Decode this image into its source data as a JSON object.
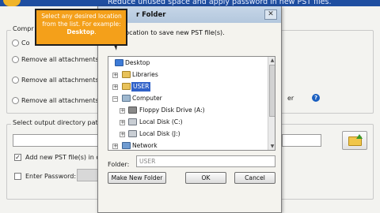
{
  "background_app": {
    "header_text": "Reduce unused space and apply password in new PST files.",
    "group_compress_label": "Compr",
    "radio_compact_label": "Co",
    "radio_remove_all_1": "Remove all attachments in",
    "radio_remove_all_2": "Remove all attachments fr",
    "radio_remove_all_3": "Remove all attachments fr",
    "radio_right_label": "er",
    "output_path_label": "Select output directory path fo",
    "add_new_pst_label": "Add new PST file(s) in ou",
    "enter_password_label": "Enter Password:",
    "colors": {
      "header": "#1f4ea0",
      "help_icon": "#1a5fc0"
    }
  },
  "dialog": {
    "title": "r Folder",
    "close_glyph": "✕",
    "instruction": "location to save new PST file(s).",
    "tree": [
      {
        "label": "Desktop",
        "expander": ""
      },
      {
        "label": "Libraries",
        "expander": "+"
      },
      {
        "label": "USER",
        "expander": "+",
        "selected": true
      },
      {
        "label": "Computer",
        "expander": "−"
      },
      {
        "label": "Floppy Disk Drive (A:)",
        "expander": "+"
      },
      {
        "label": "Local Disk (C:)",
        "expander": "+"
      },
      {
        "label": "Local Disk (J:)",
        "expander": "+"
      },
      {
        "label": "Network",
        "expander": "+"
      }
    ],
    "folder_label": "Folder:",
    "folder_value": "USER",
    "make_new_folder": "Make New Folder",
    "ok": "OK",
    "cancel": "Cancel"
  },
  "callout": {
    "text": "Select any desired location from the list. For example:",
    "bold": "Desktop",
    "suffix": "."
  }
}
